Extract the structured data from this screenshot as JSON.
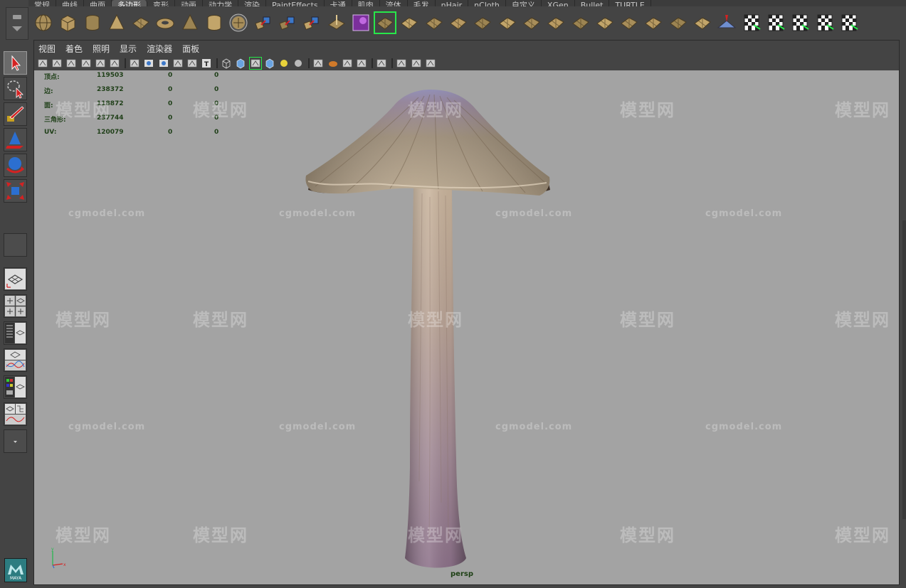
{
  "shelf_tabs": [
    {
      "label": "常规",
      "active": false
    },
    {
      "label": "曲线",
      "active": false
    },
    {
      "label": "曲面",
      "active": false
    },
    {
      "label": "多边形",
      "active": true
    },
    {
      "label": "变形",
      "active": false
    },
    {
      "label": "动画",
      "active": false
    },
    {
      "label": "动力学",
      "active": false
    },
    {
      "label": "渲染",
      "active": false
    },
    {
      "label": "PaintEffects",
      "active": false
    },
    {
      "label": "卡通",
      "active": false
    },
    {
      "label": "肌肉",
      "active": false
    },
    {
      "label": "流体",
      "active": false
    },
    {
      "label": "毛发",
      "active": false
    },
    {
      "label": "nHair",
      "active": false
    },
    {
      "label": "nCloth",
      "active": false
    },
    {
      "label": "自定义",
      "active": false
    },
    {
      "label": "XGen",
      "active": false
    },
    {
      "label": "Bullet",
      "active": false
    },
    {
      "label": "TURTLE",
      "active": false
    }
  ],
  "shelf_icons": [
    "poly-sphere-icon",
    "poly-cube-icon",
    "poly-cylinder-icon",
    "poly-cone-icon",
    "poly-plane-icon",
    "poly-torus-icon",
    "poly-pyramid-icon",
    "poly-pipe-icon",
    "poly-helix-icon",
    "combine-icon",
    "separate-icon",
    "extract-icon",
    "smooth-icon",
    "boolean-icon",
    "mirror-icon",
    "bridge-icon",
    "append-polygon-icon",
    "fill-hole-icon",
    "extrude-icon",
    "bevel-icon",
    "merge-vertices-icon",
    "cut-faces-icon",
    "split-polygon-icon",
    "insert-edge-loop-icon",
    "offset-edge-loop-icon",
    "wedge-icon",
    "soften-edge-icon",
    "harden-edge-icon",
    "sculpt-geometry-icon",
    "planar-mapping-icon",
    "cylindrical-mapping-icon",
    "spherical-mapping-icon",
    "automatic-mapping-icon",
    "uv-editor-icon"
  ],
  "panel_menu": [
    "视图",
    "着色",
    "照明",
    "显示",
    "渲染器",
    "面板"
  ],
  "hud": {
    "rows": [
      {
        "label": "顶点:",
        "v1": "119503",
        "v2": "0",
        "v3": "0"
      },
      {
        "label": "边:",
        "v1": "238372",
        "v2": "0",
        "v3": "0"
      },
      {
        "label": "面:",
        "v1": "118872",
        "v2": "0",
        "v3": "0"
      },
      {
        "label": "三角形:",
        "v1": "237744",
        "v2": "0",
        "v3": "0"
      },
      {
        "label": "UV:",
        "v1": "120079",
        "v2": "0",
        "v3": "0"
      }
    ]
  },
  "watermark": {
    "site": "cgmodel.com",
    "brand": "模型网"
  },
  "camera_label": "persp",
  "logo_text": "MAYA",
  "colors": {
    "highlight": "#27e84a",
    "viewport_bg": "#a3a3a3",
    "hud_text": "#1f3f18"
  }
}
